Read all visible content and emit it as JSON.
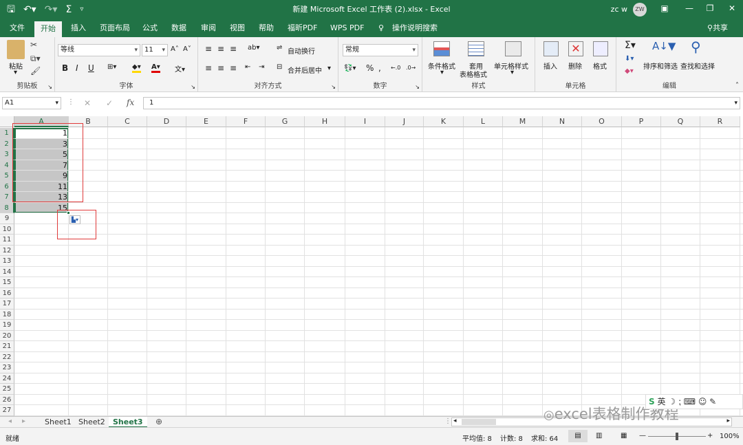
{
  "titlebar": {
    "title": "新建 Microsoft Excel 工作表 (2).xlsx  -  Excel",
    "user": "zc w",
    "avatar": "ZW",
    "share": "共享"
  },
  "tabs": [
    "文件",
    "开始",
    "插入",
    "页面布局",
    "公式",
    "数据",
    "审阅",
    "视图",
    "帮助",
    "福昕PDF",
    "WPS PDF",
    "操作说明搜索"
  ],
  "ribbon": {
    "clipboard": {
      "paste": "粘贴",
      "label": "剪贴板"
    },
    "font": {
      "name": "等线",
      "size": "11",
      "bold": "B",
      "italic": "I",
      "underline": "U",
      "label": "字体"
    },
    "align": {
      "wrap": "自动换行",
      "merge": "合并后居中",
      "label": "对齐方式"
    },
    "number": {
      "format": "常规",
      "percent": "%",
      "comma": ",",
      "label": "数字"
    },
    "styles": {
      "cond": "条件格式",
      "table_1": "套用",
      "table_2": "表格格式",
      "cell": "单元格样式",
      "label": "样式"
    },
    "cells": {
      "insert": "插入",
      "delete": "删除",
      "format": "格式",
      "label": "单元格"
    },
    "editing": {
      "sort": "排序和筛选",
      "find": "查找和选择",
      "label": "编辑"
    }
  },
  "formula_bar": {
    "namebox": "A1",
    "fx": "fx",
    "value": "1"
  },
  "columns": [
    "A",
    "B",
    "C",
    "D",
    "E",
    "F",
    "G",
    "H",
    "I",
    "J",
    "K",
    "L",
    "M",
    "N",
    "O",
    "P",
    "Q",
    "R"
  ],
  "rows": [
    "1",
    "2",
    "3",
    "4",
    "5",
    "6",
    "7",
    "8",
    "9",
    "10",
    "11",
    "12",
    "13",
    "14",
    "15",
    "16",
    "17",
    "18",
    "19",
    "20",
    "21",
    "22",
    "23",
    "24",
    "25",
    "26",
    "27"
  ],
  "cells_a": [
    "1",
    "3",
    "5",
    "7",
    "9",
    "11",
    "13",
    "15"
  ],
  "sheets": [
    "Sheet1",
    "Sheet2",
    "Sheet3"
  ],
  "active_sheet": "Sheet3",
  "status": {
    "ready": "就绪",
    "avg": "平均值: 8",
    "count": "计数: 8",
    "sum": "求和: 64",
    "zoom": "100%"
  },
  "watermark": "excel表格制作教程",
  "colors": {
    "accent": "#217346",
    "selection": "#c6c6c6",
    "highlight_box": "#e03a3a"
  }
}
